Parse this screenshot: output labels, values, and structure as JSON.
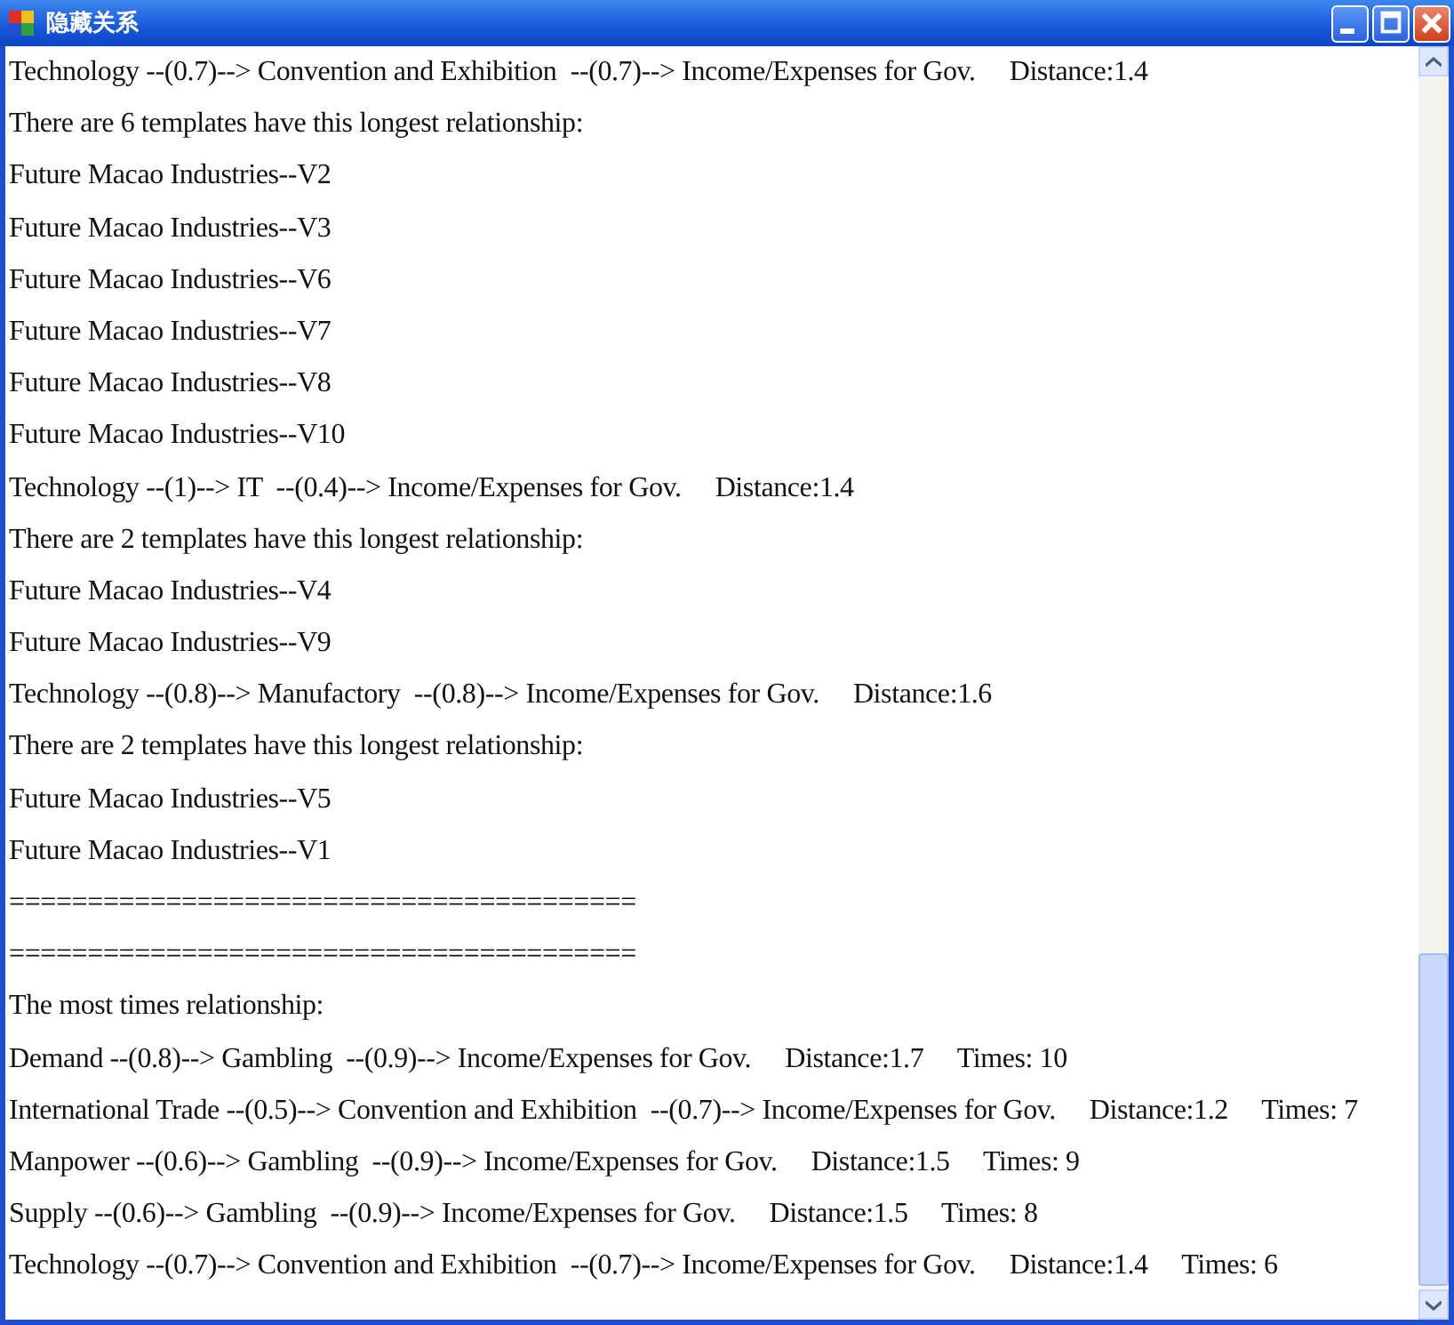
{
  "window": {
    "title": "隐藏关系"
  },
  "lines": [
    "Technology --(0.7)--> Convention and Exhibition  --(0.7)--> Income/Expenses for Gov.     Distance:1.4",
    "There are 6 templates have this longest relationship:",
    "Future Macao Industries--V2",
    "Future Macao Industries--V3",
    "Future Macao Industries--V6",
    "Future Macao Industries--V7",
    "Future Macao Industries--V8",
    "Future Macao Industries--V10",
    "Technology --(1)--> IT  --(0.4)--> Income/Expenses for Gov.     Distance:1.4",
    "There are 2 templates have this longest relationship:",
    "Future Macao Industries--V4",
    "Future Macao Industries--V9",
    "Technology --(0.8)--> Manufactory  --(0.8)--> Income/Expenses for Gov.     Distance:1.6",
    "There are 2 templates have this longest relationship:",
    "Future Macao Industries--V5",
    "Future Macao Industries--V1",
    "========================================",
    "========================================",
    "The most times relationship:",
    "Demand --(0.8)--> Gambling  --(0.9)--> Income/Expenses for Gov.     Distance:1.7     Times: 10",
    "International Trade --(0.5)--> Convention and Exhibition  --(0.7)--> Income/Expenses for Gov.     Distance:1.2     Times: 7",
    "Manpower --(0.6)--> Gambling  --(0.9)--> Income/Expenses for Gov.     Distance:1.5     Times: 9",
    "Supply --(0.6)--> Gambling  --(0.9)--> Income/Expenses for Gov.     Distance:1.5     Times: 8",
    "Technology --(0.7)--> Convention and Exhibition  --(0.7)--> Income/Expenses for Gov.     Distance:1.4     Times: 6"
  ]
}
